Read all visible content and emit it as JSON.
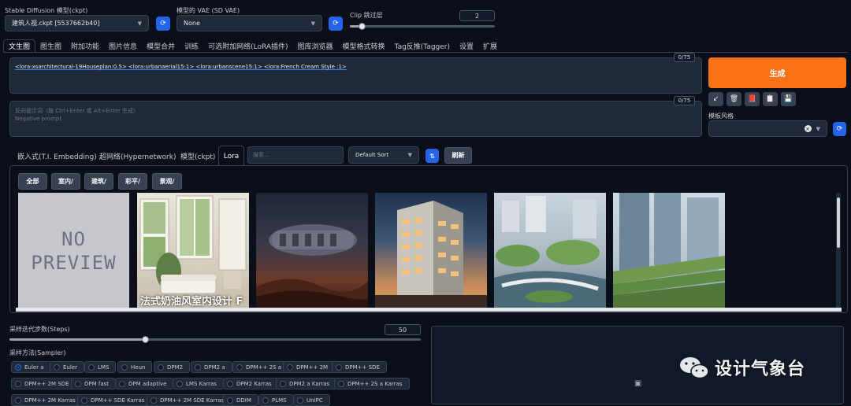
{
  "top": {
    "model_label": "Stable Diffusion 模型(ckpt)",
    "model_value": "建筑人视.ckpt [5537662b40]",
    "vae_label": "模型的 VAE (SD VAE)",
    "vae_value": "None",
    "clip_label": "Clip 跳过层",
    "clip_value": "2",
    "clip_fraction": 0.08
  },
  "tabs": [
    "文生图",
    "图生图",
    "附加功能",
    "图片信息",
    "模型合并",
    "训练",
    "可选附加网络(LoRA插件)",
    "图库浏览器",
    "模型格式转换",
    "Tag反推(Tagger)",
    "设置",
    "扩展"
  ],
  "prompt": {
    "text": "<lora:xsarchitectural-19Houseplan:0.5> <lora:urbanaerial15:1> <lora:urbanscene15:1> <lora:French Cream Style :1>",
    "counter": "0/75"
  },
  "negative": {
    "placeholder": "反向提示词（按 Ctrl+Enter 或 Alt+Enter 生成）",
    "placeholder2": "Negative prompt",
    "counter": "0/75"
  },
  "generate_label": "生成",
  "style_label": "模板风格",
  "tool_icons": [
    "↙",
    "🗑",
    "📕",
    "📋",
    "💾"
  ],
  "network_tabs": [
    "嵌入式(T.I. Embedding)",
    "超网络(Hypernetwork)",
    "模型(ckpt)",
    "Lora"
  ],
  "search_placeholder": "搜索...",
  "sort_value": "Default Sort",
  "refresh_label": "刷新",
  "filters": [
    "全部",
    "室内/",
    "建筑/",
    "彩平/",
    "景观/"
  ],
  "cards": {
    "no_preview": "NO\nPREVIEW",
    "card2_title": "法式奶油风室内设计 F"
  },
  "steps": {
    "label": "采样迭代步数(Steps)",
    "value": "50",
    "fraction": 0.33
  },
  "sampler": {
    "label": "采样方法(Sampler)",
    "selected": "Euler a",
    "options": [
      "Euler a",
      "Euler",
      "LMS",
      "Heun",
      "DPM2",
      "DPM2 a",
      "DPM++ 2S a",
      "DPM++ 2M",
      "DPM++ SDE",
      "DPM++ 2M SDE",
      "DPM fast",
      "DPM adaptive",
      "LMS Karras",
      "DPM2 Karras",
      "DPM2 a Karras",
      "DPM++ 2S a Karras",
      "DPM++ 2M Karras",
      "DPM++ SDE Karras",
      "DPM++ 2M SDE Karras",
      "DDIM",
      "PLMS",
      "UniPC"
    ]
  },
  "watermark": "设计气象台",
  "colors": {
    "accent": "#2563eb",
    "generate": "#f97316",
    "background": "#0b0f19"
  }
}
